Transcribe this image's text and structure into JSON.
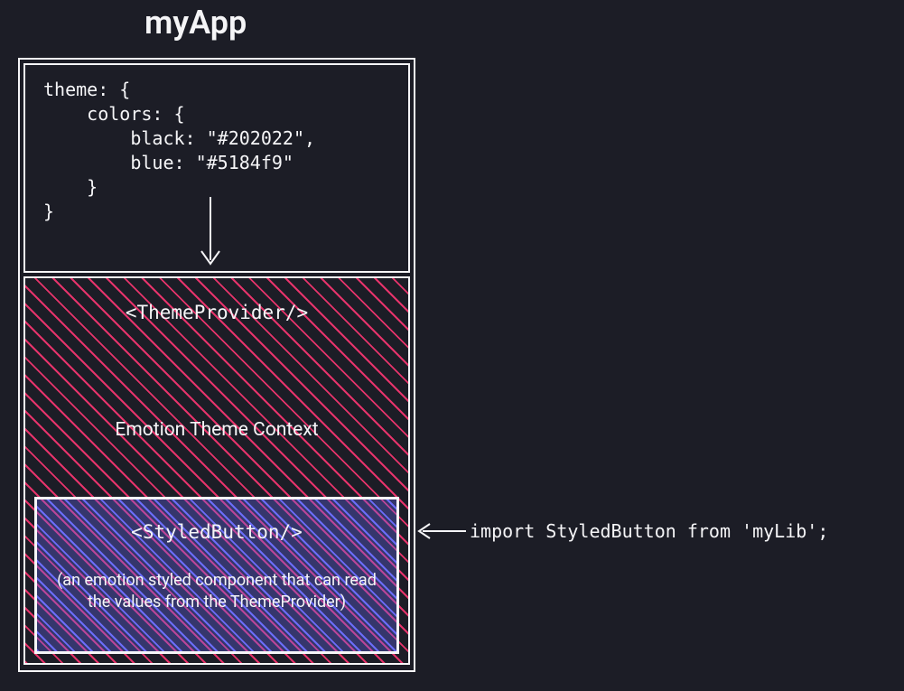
{
  "title": "myApp",
  "code": "theme: {\n    colors: {\n        black: \"#202022\",\n        blue: \"#5184f9\"\n    }\n}",
  "context": {
    "provider_label": "<ThemeProvider/>",
    "context_label": "Emotion Theme Context"
  },
  "button": {
    "label": "<StyledButton/>",
    "description": "(an emotion styled component that can read the values from the ThemeProvider)"
  },
  "import_line": "import StyledButton from 'myLib';",
  "colors": {
    "bg": "#1c1d26",
    "fg": "#f5f5f7",
    "pink": "#e6336b",
    "indigo": "#6b6df9"
  }
}
